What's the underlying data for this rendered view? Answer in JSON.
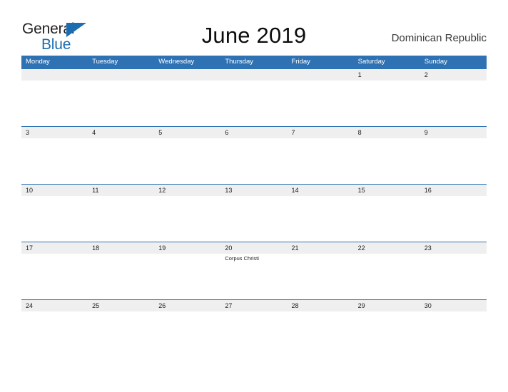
{
  "logo": {
    "word_one": "General",
    "word_two": "Blue",
    "triangle_color": "#1b6cb0",
    "text_color": "#231f20"
  },
  "header": {
    "title": "June 2019",
    "country": "Dominican Republic"
  },
  "theme": {
    "header_blue": "#2e72b4",
    "band_gray": "#efefef",
    "text_dark": "#1c1c1c",
    "page_background": "#ffffff"
  },
  "calendar": {
    "weekdays": [
      "Monday",
      "Tuesday",
      "Wednesday",
      "Thursday",
      "Friday",
      "Saturday",
      "Sunday"
    ],
    "weeks": [
      [
        {
          "date": "",
          "event": ""
        },
        {
          "date": "",
          "event": ""
        },
        {
          "date": "",
          "event": ""
        },
        {
          "date": "",
          "event": ""
        },
        {
          "date": "",
          "event": ""
        },
        {
          "date": "1",
          "event": ""
        },
        {
          "date": "2",
          "event": ""
        }
      ],
      [
        {
          "date": "3",
          "event": ""
        },
        {
          "date": "4",
          "event": ""
        },
        {
          "date": "5",
          "event": ""
        },
        {
          "date": "6",
          "event": ""
        },
        {
          "date": "7",
          "event": ""
        },
        {
          "date": "8",
          "event": ""
        },
        {
          "date": "9",
          "event": ""
        }
      ],
      [
        {
          "date": "10",
          "event": ""
        },
        {
          "date": "11",
          "event": ""
        },
        {
          "date": "12",
          "event": ""
        },
        {
          "date": "13",
          "event": ""
        },
        {
          "date": "14",
          "event": ""
        },
        {
          "date": "15",
          "event": ""
        },
        {
          "date": "16",
          "event": ""
        }
      ],
      [
        {
          "date": "17",
          "event": ""
        },
        {
          "date": "18",
          "event": ""
        },
        {
          "date": "19",
          "event": ""
        },
        {
          "date": "20",
          "event": "Corpus Christi"
        },
        {
          "date": "21",
          "event": ""
        },
        {
          "date": "22",
          "event": ""
        },
        {
          "date": "23",
          "event": ""
        }
      ],
      [
        {
          "date": "24",
          "event": ""
        },
        {
          "date": "25",
          "event": ""
        },
        {
          "date": "26",
          "event": ""
        },
        {
          "date": "27",
          "event": ""
        },
        {
          "date": "28",
          "event": ""
        },
        {
          "date": "29",
          "event": ""
        },
        {
          "date": "30",
          "event": ""
        }
      ]
    ]
  }
}
